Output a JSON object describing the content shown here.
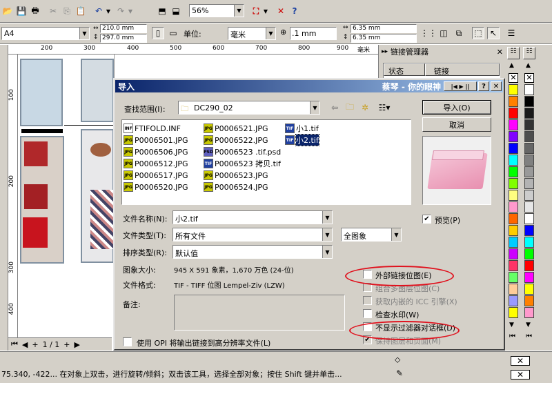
{
  "toolbar1": {
    "zoom": "56%"
  },
  "propbar": {
    "paper": "A4",
    "width": "210.0 mm",
    "height": "297.0 mm",
    "units_label": "单位:",
    "units": "毫米",
    "nudge": ".1 mm",
    "dup_x": "6.35 mm",
    "dup_y": "6.35 mm"
  },
  "ruler": {
    "ticks": [
      "200",
      "300",
      "400",
      "500",
      "600",
      "700",
      "800",
      "900"
    ],
    "unit": "毫米",
    "vticks": [
      "100",
      "200",
      "300",
      "400"
    ]
  },
  "page_nav": {
    "page": "1 / 1"
  },
  "link_panel": {
    "title": "链接管理器",
    "col_status": "状态",
    "col_link": "链接"
  },
  "dialog": {
    "title": "导入",
    "title_right": "蔡琴 - 你的眼神",
    "look_in_label": "查找范围(I):",
    "look_in_value": "DC290_02",
    "files_col1": [
      {
        "name": "FTIFOLD.INF",
        "type": "INF"
      },
      {
        "name": "P0006501.JPG",
        "type": "JPG"
      },
      {
        "name": "P0006506.JPG",
        "type": "JPG"
      },
      {
        "name": "P0006512.JPG",
        "type": "JPG"
      },
      {
        "name": "P0006517.JPG",
        "type": "JPG"
      },
      {
        "name": "P0006520.JPG",
        "type": "JPG"
      }
    ],
    "files_col2": [
      {
        "name": "P0006521.JPG",
        "type": "JPG"
      },
      {
        "name": "P0006522.JPG",
        "type": "JPG"
      },
      {
        "name": "P0006523 .tif.psd",
        "type": "PSD"
      },
      {
        "name": "P0006523 拷贝.tif",
        "type": "TIF"
      },
      {
        "name": "P0006523.JPG",
        "type": "JPG"
      },
      {
        "name": "P0006524.JPG",
        "type": "JPG"
      }
    ],
    "files_col3": [
      {
        "name": "小1.tif",
        "type": "TIF"
      },
      {
        "name": "小2.tif",
        "type": "TIF",
        "selected": true
      }
    ],
    "filename_label": "文件名称(N):",
    "filename_value": "小2.tif",
    "filetype_label": "文件类型(T):",
    "filetype_value": "所有文件",
    "filter_value": "全图象",
    "sort_label": "排序类型(R):",
    "sort_value": "默认值",
    "imgsize_label": "图象大小:",
    "imgsize_value": "945 X 591 象素，1,670 万色 (24-位)",
    "format_label": "文件格式:",
    "format_value": "TIF - TIFF 位图 Lempel-Ziv (LZW)",
    "notes_label": "备注:",
    "opi_label": "使用 OPI 将输出链接到高分辨率文件(L)",
    "import_button": "导入(O)",
    "cancel_button": "取消",
    "preview_label": "预览(P)",
    "options": [
      {
        "label": "外部链接位图(E)",
        "enabled": true,
        "checked": false
      },
      {
        "label": "组合多图层位图(C)",
        "enabled": false,
        "checked": false
      },
      {
        "label": "获取内嵌的 ICC 引擎(X)",
        "enabled": false,
        "checked": false
      },
      {
        "label": "检查水印(W)",
        "enabled": true,
        "checked": false
      },
      {
        "label": "不显示过滤器对话框(D)",
        "enabled": true,
        "checked": false
      },
      {
        "label": "保持图层和页面(M)",
        "enabled": false,
        "checked": true
      }
    ]
  },
  "status": {
    "text": "75.340, -422...  在对象上双击，进行旋转/倾斜；双击该工具，选择全部对象；按住 Shift 键并单击..."
  },
  "colors": {
    "titlebar": "#0a246a",
    "highlight": "#e0121e",
    "palette": [
      "#ffffff",
      "#000000",
      "#1a1a1a",
      "#333333",
      "#4d4d4d",
      "#666666",
      "#808080",
      "#999999",
      "#b3b3b3",
      "#cccccc",
      "#e6e6e6",
      "#ffffff",
      "#0000ff",
      "#00ffff",
      "#00ff00",
      "#ff0000",
      "#ff00ff",
      "#ffff00",
      "#ff8000",
      "#ff99cc"
    ]
  }
}
